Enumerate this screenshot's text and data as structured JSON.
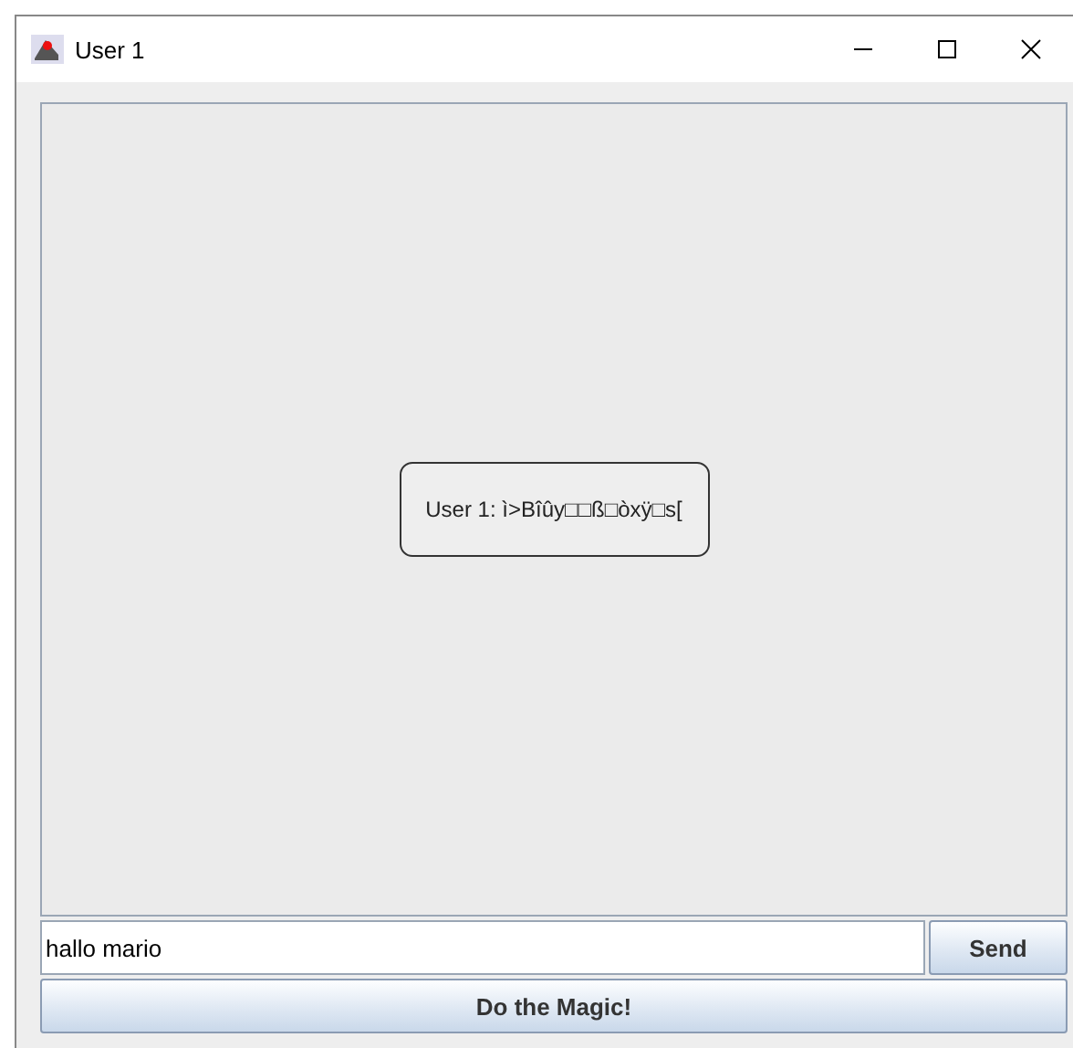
{
  "window": {
    "title": "User 1"
  },
  "chat": {
    "messages": [
      {
        "text": "User 1: ì>Bîûy□□ß□òxÿ□s["
      }
    ]
  },
  "input": {
    "value": "hallo mario"
  },
  "buttons": [
    {
      "kind": "send",
      "label": "Send"
    },
    {
      "kind": "magic",
      "label": "Do the Magic!"
    }
  ]
}
